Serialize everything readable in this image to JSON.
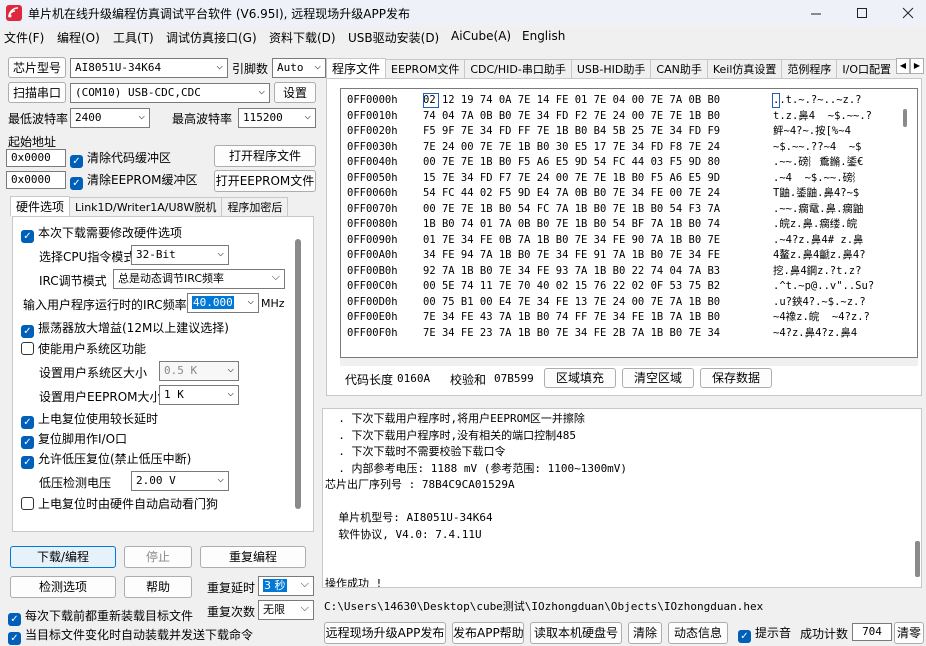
{
  "window": {
    "title": "单片机在线升级编程仿真调试平台软件 (V6.95I), 远程现场升级APP发布"
  },
  "menu": [
    "文件(F)",
    "编程(O)",
    "工具(T)",
    "调试仿真接口(G)",
    "资料下载(D)",
    "USB驱动安装(D)",
    "AiCube(A)",
    "English"
  ],
  "left": {
    "chip_label": "芯片型号",
    "chip_value": "AI8051U-34K64",
    "pin_label": "引脚数",
    "pin_value": "Auto",
    "scan_button": "扫描串口",
    "port_value": "(COM10) USB-CDC,CDC",
    "settings_button": "设置",
    "min_baud_label": "最低波特率",
    "min_baud_value": "2400",
    "max_baud_label": "最高波特率",
    "max_baud_value": "115200",
    "start_addr_label": "起始地址",
    "addr1": "0x0000",
    "clear_code_label": "清除代码缓冲区",
    "open_program_button": "打开程序文件",
    "addr2": "0x0000",
    "clear_eeprom_label": "清除EEPROM缓冲区",
    "open_eeprom_button": "打开EEPROM文件"
  },
  "hw_tabs": [
    "硬件选项",
    "Link1D/Writer1A/U8W脱机",
    "程序加密后"
  ],
  "hw": {
    "opt_modify": "本次下载需要修改硬件选项",
    "cpu_mode_label": "选择CPU指令模式",
    "cpu_mode_value": "32-Bit",
    "irc_mode_label": "IRC调节模式",
    "irc_mode_value": "总是动态调节IRC频率",
    "irc_freq_label": "输入用户程序运行时的IRC频率",
    "irc_freq_value": "40.000",
    "irc_freq_unit": "MHz",
    "opt_osc": "振荡器放大增益(12M以上建议选择)",
    "opt_sysarea": "使能用户系统区功能",
    "sysarea_label": "设置用户系统区大小",
    "sysarea_value": "0.5 K",
    "eeprom_label": "设置用户EEPROM大小",
    "eeprom_value": "1   K",
    "opt_delay": "上电复位使用较长延时",
    "opt_resetio": "复位脚用作I/O口",
    "opt_lvd": "允许低压复位(禁止低压中断)",
    "lvd_label": "低压检测电压",
    "lvd_value": "2.00 V",
    "opt_wdt": "上电复位时由硬件自动启动看门狗"
  },
  "actions": {
    "download": "下载/编程",
    "stop": "停止",
    "reprogram": "重复编程",
    "check": "检测选项",
    "help": "帮助",
    "delay_label": "重复延时",
    "delay_value": "3 秒",
    "count_label": "重复次数",
    "count_value": "无限",
    "reload_each": "每次下载前都重新装载目标文件",
    "auto_send": "当目标文件变化时自动装载并发送下载命令"
  },
  "right_tabs": [
    "程序文件",
    "EEPROM文件",
    "CDC/HID-串口助手",
    "USB-HID助手",
    "CAN助手",
    "Keil仿真设置",
    "范例程序",
    "I/O口配置"
  ],
  "hex_rows": [
    {
      "addr": "0FF0000h",
      "bytes": "02 12 19 74 0A 7E 14 FE 01 7E 04 00 7E 7A 0B B0",
      "ascii": "..t.~.?~..~z.?"
    },
    {
      "addr": "0FF0010h",
      "bytes": "74 04 7A 0B B0 7E 34 FD F2 7E 24 00 7E 7E 1B B0",
      "ascii": "t.z.鼻4  ~$.~~.?"
    },
    {
      "addr": "0FF0020h",
      "bytes": "F5 9F 7E 34 FD FF 7E 1B B0 B4 5B 25 7E 34 FD F9",
      "ascii": "鲆~4?~.按[%~4"
    },
    {
      "addr": "0FF0030h",
      "bytes": "7E 24 00 7E 7E 1B B0 30 E5 17 7E 34 FD F8 7E 24",
      "ascii": "~$.~~.??~4  ~$"
    },
    {
      "addr": "0FF0040h",
      "bytes": "00 7E 7E 1B B0 F5 A6 E5 9D 54 FC 44 03 F5 9D 80",
      "ascii": ".~~.磅︴穒鏅.鋈€"
    },
    {
      "addr": "0FF0050h",
      "bytes": "15 7E 34 FD F7 7E 24 00 7E 7E 1B B0 F5 A6 E5 9D",
      "ascii": ".~4  ~$.~~.磅︴"
    },
    {
      "addr": "0FF0060h",
      "bytes": "54 FC 44 02 F5 9D E4 7A 0B B0 7E 34 FE 00 7E 24",
      "ascii": "T鼬.鋈鼬.鼻4?~$"
    },
    {
      "addr": "0FF0070h",
      "bytes": "00 7E 7E 1B B0 54 FC 7A 1B B0 7E 1B B0 54 F3 7A",
      "ascii": ".~~.瘸鼋.鼻.瘸鼬"
    },
    {
      "addr": "0FF0080h",
      "bytes": "1B B0 74 01 7A 0B B0 7E 1B B0 54 BF 7A 1B B0 74",
      "ascii": ".皖z.鼻.瘸缕.皖"
    },
    {
      "addr": "0FF0090h",
      "bytes": "01 7E 34 FE 0B 7A 1B B0 7E 34 FE 90 7A 1B B0 7E",
      "ascii": ".~4?z.鼻4# z.鼻"
    },
    {
      "addr": "0FF00A0h",
      "bytes": "34 FE 94 7A 1B B0 7E 34 FE 91 7A 1B B0 7E 34 FE",
      "ascii": "4鳌z.鼻4䶵z.鼻4?"
    },
    {
      "addr": "0FF00B0h",
      "bytes": "92 7A 1B B0 7E 34 FE 93 7A 1B B0 22 74 04 7A B3",
      "ascii": "挖.鼻4鋼z.?t.z?"
    },
    {
      "addr": "0FF00C0h",
      "bytes": "00 5E 74 11 7E 70 40 02 15 76 22 02 0F 53 75 B2",
      "ascii": ".^t.~p@..v\"..Su?"
    },
    {
      "addr": "0FF00D0h",
      "bytes": "00 75 B1 00 E4 7E 34 FE 13 7E 24 00 7E 7A 1B B0",
      "ascii": ".u?鋏4?.~$.~z.?"
    },
    {
      "addr": "0FF00E0h",
      "bytes": "7E 34 FE 43 7A 1B B0 74 FF 7E 34 FE 1B 7A 1B B0",
      "ascii": "~4襐z.皖  ~4?z.?"
    },
    {
      "addr": "0FF00F0h",
      "bytes": "7E 34 FE 23 7A 1B B0 7E 34 FE 2B 7A 1B B0 7E 34",
      "ascii": "~4?z.鼻4?z.鼻4"
    }
  ],
  "hex_footer": {
    "code_len_label": "代码长度",
    "code_len_value": "0160A",
    "checksum_label": "校验和",
    "checksum_value": "07B599",
    "fill_button": "区域填充",
    "clear_button": "清空区域",
    "save_button": "保存数据"
  },
  "log_lines": [
    "  . 下次下载用户程序时,将用户EEPROM区一并擦除",
    "  . 下次下载用户程序时,没有相关的端口控制485",
    "  . 下次下载时不需要校验下载口令",
    "  . 内部参考电压: 1188 mV (参考范围: 1100~1300mV)",
    "芯片出厂序列号 : 78B4C9CA01529A",
    "",
    "  单片机型号: AI8051U-34K64",
    "  软件协议, V4.0: 7.4.11U",
    "",
    "",
    "操作成功 !"
  ],
  "path": "C:\\Users\\14630\\Desktop\\cube测试\\IOzhongduan\\Objects\\IOzhongduan.hex",
  "bottom": {
    "remote_publish": "远程现场升级APP发布",
    "publish_help": "发布APP帮助",
    "read_disk": "读取本机硬盘号",
    "clear": "清除",
    "dynamic_info": "动态信息",
    "tone_label": "提示音",
    "success_label": "成功计数",
    "success_value": "704",
    "reset_button": "清零"
  }
}
